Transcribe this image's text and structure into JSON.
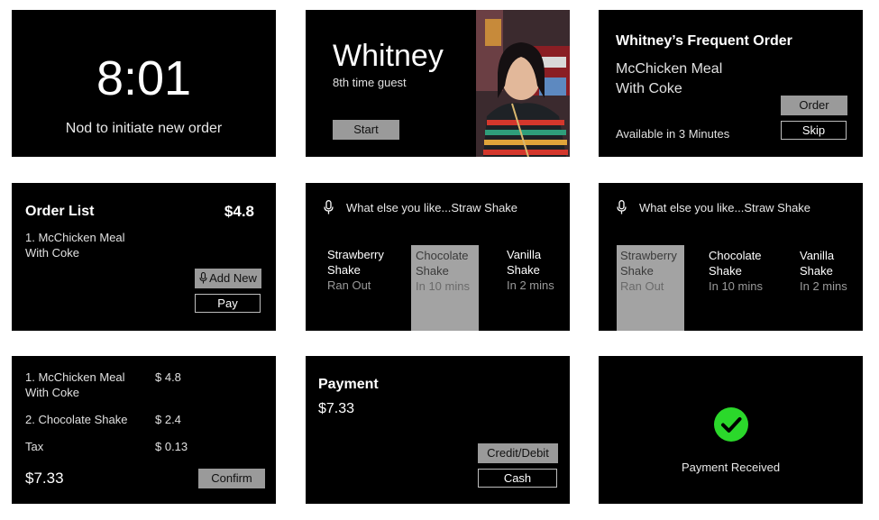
{
  "screens": {
    "idle": {
      "time": "8:01",
      "prompt": "Nod to initiate new order"
    },
    "greeting": {
      "name": "Whitney",
      "visits": "8th time guest",
      "start_label": "Start"
    },
    "frequent": {
      "title": "Whitney’s Frequent Order",
      "item_line1": "McChicken Meal",
      "item_line2": "With Coke",
      "availability": "Available in 3 Minutes",
      "order_label": "Order",
      "skip_label": "Skip"
    },
    "order_list": {
      "title": "Order List",
      "total": "$4.8",
      "item_line1": "1. McChicken Meal",
      "item_line2": "With Coke",
      "add_new_label": "Add New",
      "pay_label": "Pay"
    },
    "voice_choice_1": {
      "query": "What else you like...Straw Shake",
      "options": [
        {
          "name1": "Strawberry",
          "name2": "Shake",
          "status": "Ran Out"
        },
        {
          "name1": "Chocolate",
          "name2": "Shake",
          "status": "In 10 mins"
        },
        {
          "name1": "Vanilla",
          "name2": "Shake",
          "status": "In 2 mins"
        }
      ]
    },
    "voice_choice_2": {
      "query": "What else you like...Straw Shake",
      "options": [
        {
          "name1": "Strawberry",
          "name2": "Shake",
          "status": "Ran Out"
        },
        {
          "name1": "Chocolate",
          "name2": "Shake",
          "status": "In 10 mins"
        },
        {
          "name1": "Vanilla",
          "name2": "Shake",
          "status": "In 2 mins"
        }
      ]
    },
    "summary": {
      "item1_line1": "1. McChicken Meal",
      "item1_line2": "With Coke",
      "item1_price": "$ 4.8",
      "item2": "2. Chocolate Shake",
      "item2_price": "$ 2.4",
      "tax_label": "Tax",
      "tax_price": "$ 0.13",
      "total": "$7.33",
      "confirm_label": "Confirm"
    },
    "payment": {
      "title": "Payment",
      "amount": "$7.33",
      "credit_label": "Credit/Debit",
      "cash_label": "Cash"
    },
    "received": {
      "message": "Payment Received",
      "icon": "check-circle-icon",
      "icon_color": "#2bd82b"
    }
  },
  "icons": {
    "mic": "microphone-icon",
    "guest_photo": "guest-photo"
  },
  "colors": {
    "card_bg": "#000000",
    "button_grey": "#9a9a9a",
    "selected_option": "#a3a3a3",
    "success": "#2bd82b"
  }
}
